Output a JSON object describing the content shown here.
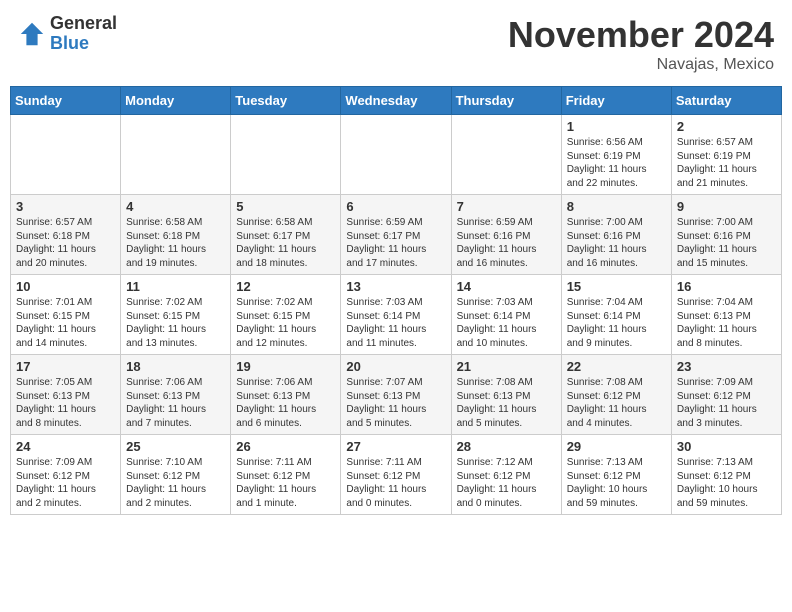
{
  "header": {
    "logo_general": "General",
    "logo_blue": "Blue",
    "month_title": "November 2024",
    "location": "Navajas, Mexico"
  },
  "weekdays": [
    "Sunday",
    "Monday",
    "Tuesday",
    "Wednesday",
    "Thursday",
    "Friday",
    "Saturday"
  ],
  "weeks": [
    [
      {
        "day": "",
        "info": ""
      },
      {
        "day": "",
        "info": ""
      },
      {
        "day": "",
        "info": ""
      },
      {
        "day": "",
        "info": ""
      },
      {
        "day": "",
        "info": ""
      },
      {
        "day": "1",
        "info": "Sunrise: 6:56 AM\nSunset: 6:19 PM\nDaylight: 11 hours and 22 minutes."
      },
      {
        "day": "2",
        "info": "Sunrise: 6:57 AM\nSunset: 6:19 PM\nDaylight: 11 hours and 21 minutes."
      }
    ],
    [
      {
        "day": "3",
        "info": "Sunrise: 6:57 AM\nSunset: 6:18 PM\nDaylight: 11 hours and 20 minutes."
      },
      {
        "day": "4",
        "info": "Sunrise: 6:58 AM\nSunset: 6:18 PM\nDaylight: 11 hours and 19 minutes."
      },
      {
        "day": "5",
        "info": "Sunrise: 6:58 AM\nSunset: 6:17 PM\nDaylight: 11 hours and 18 minutes."
      },
      {
        "day": "6",
        "info": "Sunrise: 6:59 AM\nSunset: 6:17 PM\nDaylight: 11 hours and 17 minutes."
      },
      {
        "day": "7",
        "info": "Sunrise: 6:59 AM\nSunset: 6:16 PM\nDaylight: 11 hours and 16 minutes."
      },
      {
        "day": "8",
        "info": "Sunrise: 7:00 AM\nSunset: 6:16 PM\nDaylight: 11 hours and 16 minutes."
      },
      {
        "day": "9",
        "info": "Sunrise: 7:00 AM\nSunset: 6:16 PM\nDaylight: 11 hours and 15 minutes."
      }
    ],
    [
      {
        "day": "10",
        "info": "Sunrise: 7:01 AM\nSunset: 6:15 PM\nDaylight: 11 hours and 14 minutes."
      },
      {
        "day": "11",
        "info": "Sunrise: 7:02 AM\nSunset: 6:15 PM\nDaylight: 11 hours and 13 minutes."
      },
      {
        "day": "12",
        "info": "Sunrise: 7:02 AM\nSunset: 6:15 PM\nDaylight: 11 hours and 12 minutes."
      },
      {
        "day": "13",
        "info": "Sunrise: 7:03 AM\nSunset: 6:14 PM\nDaylight: 11 hours and 11 minutes."
      },
      {
        "day": "14",
        "info": "Sunrise: 7:03 AM\nSunset: 6:14 PM\nDaylight: 11 hours and 10 minutes."
      },
      {
        "day": "15",
        "info": "Sunrise: 7:04 AM\nSunset: 6:14 PM\nDaylight: 11 hours and 9 minutes."
      },
      {
        "day": "16",
        "info": "Sunrise: 7:04 AM\nSunset: 6:13 PM\nDaylight: 11 hours and 8 minutes."
      }
    ],
    [
      {
        "day": "17",
        "info": "Sunrise: 7:05 AM\nSunset: 6:13 PM\nDaylight: 11 hours and 8 minutes."
      },
      {
        "day": "18",
        "info": "Sunrise: 7:06 AM\nSunset: 6:13 PM\nDaylight: 11 hours and 7 minutes."
      },
      {
        "day": "19",
        "info": "Sunrise: 7:06 AM\nSunset: 6:13 PM\nDaylight: 11 hours and 6 minutes."
      },
      {
        "day": "20",
        "info": "Sunrise: 7:07 AM\nSunset: 6:13 PM\nDaylight: 11 hours and 5 minutes."
      },
      {
        "day": "21",
        "info": "Sunrise: 7:08 AM\nSunset: 6:13 PM\nDaylight: 11 hours and 5 minutes."
      },
      {
        "day": "22",
        "info": "Sunrise: 7:08 AM\nSunset: 6:12 PM\nDaylight: 11 hours and 4 minutes."
      },
      {
        "day": "23",
        "info": "Sunrise: 7:09 AM\nSunset: 6:12 PM\nDaylight: 11 hours and 3 minutes."
      }
    ],
    [
      {
        "day": "24",
        "info": "Sunrise: 7:09 AM\nSunset: 6:12 PM\nDaylight: 11 hours and 2 minutes."
      },
      {
        "day": "25",
        "info": "Sunrise: 7:10 AM\nSunset: 6:12 PM\nDaylight: 11 hours and 2 minutes."
      },
      {
        "day": "26",
        "info": "Sunrise: 7:11 AM\nSunset: 6:12 PM\nDaylight: 11 hours and 1 minute."
      },
      {
        "day": "27",
        "info": "Sunrise: 7:11 AM\nSunset: 6:12 PM\nDaylight: 11 hours and 0 minutes."
      },
      {
        "day": "28",
        "info": "Sunrise: 7:12 AM\nSunset: 6:12 PM\nDaylight: 11 hours and 0 minutes."
      },
      {
        "day": "29",
        "info": "Sunrise: 7:13 AM\nSunset: 6:12 PM\nDaylight: 10 hours and 59 minutes."
      },
      {
        "day": "30",
        "info": "Sunrise: 7:13 AM\nSunset: 6:12 PM\nDaylight: 10 hours and 59 minutes."
      }
    ]
  ]
}
